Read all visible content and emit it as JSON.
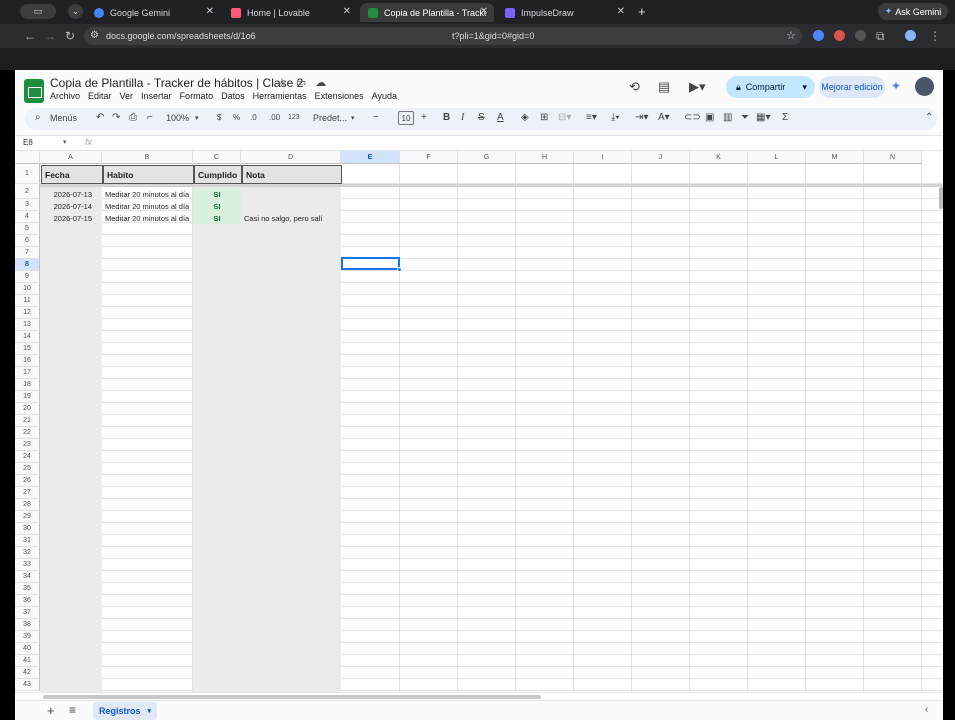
{
  "browser": {
    "tabs": [
      {
        "label": "Google Gemini",
        "color": "#4285f4"
      },
      {
        "label": "Home | Lovable",
        "color": "#ff5a7a"
      },
      {
        "label": "Copia de Plantilla - Tracker d",
        "color": "#1e8e3e"
      },
      {
        "label": "ImpulseDraw",
        "color": "#7b61ff"
      }
    ],
    "ask_gemini": "Ask Gemini",
    "url_left": "docs.google.com/spreadsheets/d/1o6",
    "url_right": "t?pli=1&gid=0#gid=0"
  },
  "sheets": {
    "title": "Copia de Plantilla - Tracker de hábitos | Clase 2",
    "menu": [
      "Archivo",
      "Editar",
      "Ver",
      "Insertar",
      "Formato",
      "Datos",
      "Herramientas",
      "Extensiones",
      "Ayuda"
    ],
    "share_label": "Compartir",
    "improve_label": "Mejorar edición",
    "toolbar": {
      "menus_label": "Menús",
      "zoom": "100%",
      "currency": "$",
      "percent": "%",
      "dec_less": ".0",
      "dec_more": ".00",
      "number_format": "123",
      "font": "Predet...",
      "font_size": "10"
    },
    "namebox": "E8",
    "fx": "fx"
  },
  "grid": {
    "columns": [
      "A",
      "B",
      "C",
      "D",
      "E",
      "F",
      "G",
      "H",
      "I",
      "J",
      "K",
      "L",
      "M",
      "N"
    ],
    "rows": [
      "1",
      "2",
      "3",
      "4",
      "5",
      "6",
      "7",
      "8",
      "9",
      "10",
      "11",
      "12",
      "13",
      "14",
      "15",
      "16",
      "17",
      "18",
      "19",
      "20",
      "21",
      "22",
      "23",
      "24",
      "25",
      "26",
      "27",
      "28",
      "29",
      "30",
      "31",
      "32",
      "33",
      "34",
      "35",
      "36",
      "37",
      "38",
      "39",
      "40",
      "41",
      "42",
      "43"
    ],
    "selected_col": "E",
    "selected_row": "8",
    "headers": [
      "Fecha",
      "Habito",
      "Cumplido",
      "Nota"
    ],
    "data": [
      {
        "fecha": "2026-07-13",
        "habito": "Meditar 20 minutos al día",
        "cumplido": "SI",
        "nota": ""
      },
      {
        "fecha": "2026-07-14",
        "habito": "Meditar 20 minutos al día",
        "cumplido": "SI",
        "nota": ""
      },
      {
        "fecha": "2026-07-15",
        "habito": "Meditar 20 minutos al día",
        "cumplido": "SI",
        "nota": "Casi no salgo, pero salí"
      }
    ]
  },
  "sheet_tabs": [
    "Registros"
  ]
}
